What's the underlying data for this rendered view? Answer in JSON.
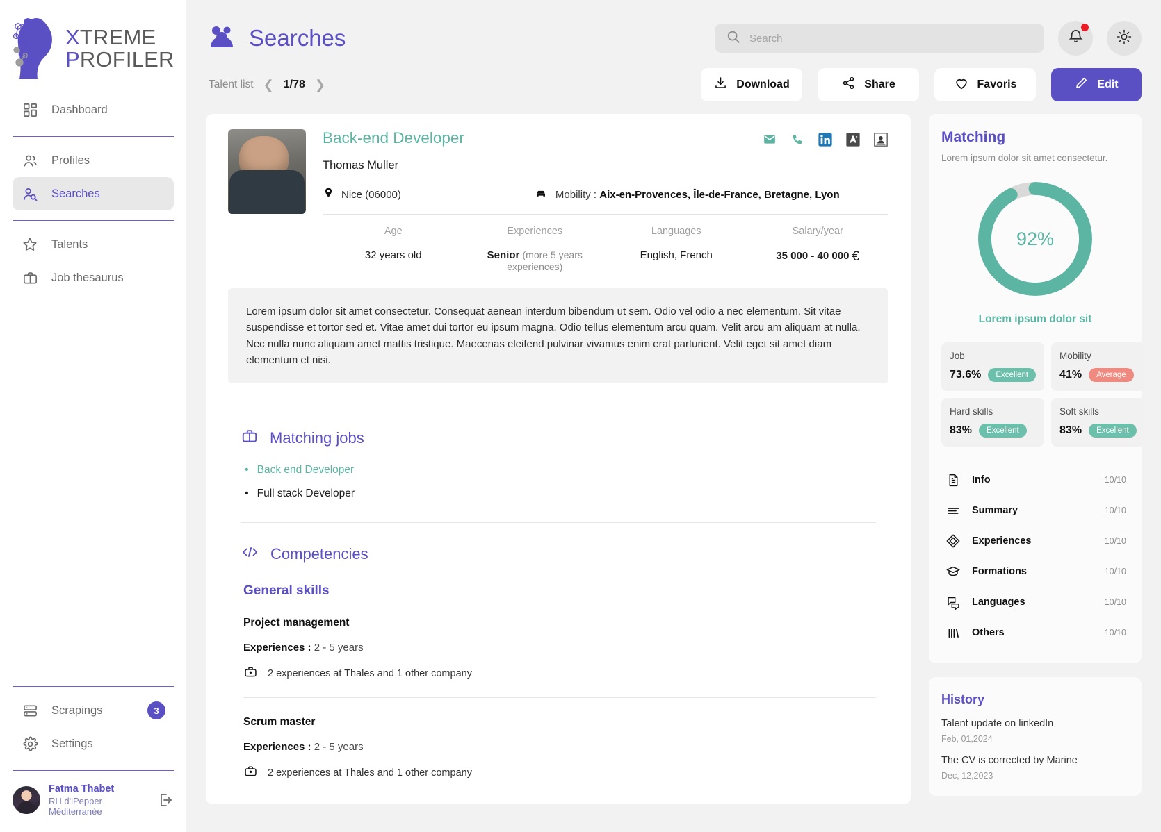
{
  "brand": {
    "line1_hl": "X",
    "line1_rest": "TREME",
    "line2_hl": "P",
    "line2_rest": "ROFILER"
  },
  "sidebar": {
    "items_top": [
      {
        "label": "Dashboard",
        "icon": "grid-icon"
      }
    ],
    "items_mid": [
      {
        "label": "Profiles",
        "icon": "users-icon"
      },
      {
        "label": "Searches",
        "icon": "user-search-icon"
      }
    ],
    "items_low": [
      {
        "label": "Talents",
        "icon": "star-icon"
      },
      {
        "label": "Job thesaurus",
        "icon": "briefcase-icon"
      }
    ],
    "items_bottom": [
      {
        "label": "Scrapings",
        "icon": "server-icon",
        "badge": "3"
      },
      {
        "label": "Settings",
        "icon": "gear-icon"
      }
    ],
    "user": {
      "name": "Fatma Thabet",
      "role": "RH d'iPepper Méditerranée"
    }
  },
  "header": {
    "title": "Searches",
    "title_icon": "group-people-icon",
    "search_placeholder": "Search",
    "search_value": "",
    "notification_icon": "bell-icon",
    "theme_icon": "sun-icon"
  },
  "breadcrumb": {
    "label": "Talent list",
    "position": "1/78",
    "prev_icon": "chevron-left-icon",
    "next_icon": "chevron-right-icon"
  },
  "actions": [
    {
      "label": "Download",
      "icon": "download-icon",
      "primary": false
    },
    {
      "label": "Share",
      "icon": "share-icon",
      "primary": false
    },
    {
      "label": "Favoris",
      "icon": "heart-icon",
      "primary": false
    },
    {
      "label": "Edit",
      "icon": "pencil-icon",
      "primary": true
    }
  ],
  "profile": {
    "job_title": "Back-end Developer",
    "name": "Thomas Muller",
    "location": "Nice (06000)",
    "location_icon": "map-pin-icon",
    "mobility_label": "Mobility :",
    "mobility_value": "Aix-en-Provences, Île-de-France, Bretagne, Lyon",
    "mobility_icon": "car-icon",
    "contact_icons": [
      "email-icon",
      "phone-icon",
      "linkedin-icon",
      "apec-icon",
      "cv-doc-icon"
    ],
    "stats": [
      {
        "label": "Age",
        "value": "32 years old",
        "bold": "",
        "sub": ""
      },
      {
        "label": "Experiences",
        "value": "",
        "bold": "Senior",
        "sub": "(more 5 years experiences)"
      },
      {
        "label": "Languages",
        "value": "English, French",
        "bold": "",
        "sub": ""
      },
      {
        "label": "Salary/year",
        "value": "",
        "bold": "35 000 - 40 000",
        "sub": ""
      }
    ],
    "salary_currency": "€",
    "description": "Lorem ipsum dolor sit amet consectetur. Consequat aenean interdum bibendum ut sem. Odio vel odio a nec elementum. Sit vitae suspendisse et tortor sed et. Vitae amet dui tortor eu ipsum magna. Odio tellus elementum arcu quam. Velit arcu am aliquam at nulla. Nec nulla nunc aliquam amet mattis tristique. Maecenas eleifend pulvinar vivamus enim erat parturient. Velit eget sit amet diam elementum et nisi."
  },
  "matching_jobs": {
    "title": "Matching jobs",
    "icon": "briefcase-icon",
    "items": [
      {
        "label": "Back end Developer",
        "highlight": true
      },
      {
        "label": "Full stack Developer",
        "highlight": false
      }
    ]
  },
  "competencies": {
    "title": "Competencies",
    "icon": "code-icon",
    "group_title": "General skills",
    "skills": [
      {
        "name": "Project management",
        "exp_label": "Experiences :",
        "exp_value": "2 - 5 years",
        "companies": "2 experiences at Thales and 1 other company",
        "company_icon": "briefcase-icon"
      },
      {
        "name": "Scrum master",
        "exp_label": "Experiences :",
        "exp_value": "2 - 5 years",
        "companies": "2 experiences at Thales and 1 other company",
        "company_icon": "briefcase-icon"
      }
    ]
  },
  "matching_panel": {
    "title": "Matching",
    "subtitle": "Lorem ipsum dolor sit amet consectetur.",
    "score_percent": "92%",
    "score_value": 92,
    "caption": "Lorem ipsum dolor sit",
    "accent_color": "#5bb5a2",
    "track_color": "#d9d9d9",
    "metrics": [
      {
        "label": "Job",
        "value": "73.6%",
        "badge": "Excellent",
        "badge_kind": "excellent"
      },
      {
        "label": "Mobility",
        "value": "41%",
        "badge": "Average",
        "badge_kind": "average"
      },
      {
        "label": "Hard skills",
        "value": "83%",
        "badge": "Excellent",
        "badge_kind": "excellent"
      },
      {
        "label": "Soft skills",
        "value": "83%",
        "badge": "Excellent",
        "badge_kind": "excellent"
      }
    ],
    "scores": [
      {
        "label": "Info",
        "value": "10/10",
        "icon": "document-icon"
      },
      {
        "label": "Summary",
        "value": "10/10",
        "icon": "lines-icon"
      },
      {
        "label": "Experiences",
        "value": "10/10",
        "icon": "cube-icon"
      },
      {
        "label": "Formations",
        "value": "10/10",
        "icon": "graduation-cap-icon"
      },
      {
        "label": "Languages",
        "value": "10/10",
        "icon": "chat-icon"
      },
      {
        "label": "Others",
        "value": "10/10",
        "icon": "bars-icon"
      }
    ]
  },
  "history": {
    "title": "History",
    "items": [
      {
        "text": "Talent update on linkedIn",
        "date": "Feb, 01,2024"
      },
      {
        "text": "The CV is corrected by Marine",
        "date": "Dec, 12,2023"
      }
    ]
  }
}
